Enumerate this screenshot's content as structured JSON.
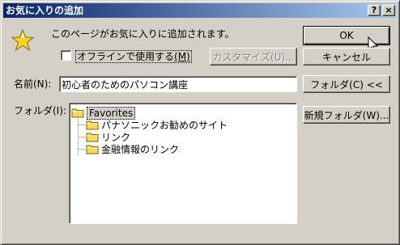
{
  "window": {
    "title": "お気に入りの追加",
    "help_btn": "?",
    "close_btn": "×"
  },
  "message": "このページがお気に入りに追加されます。",
  "offline": {
    "label_pre": "オフラインで使用する",
    "label_mnemonic": "(M)",
    "checked": false
  },
  "buttons": {
    "ok": "OK",
    "cancel": "キャンセル",
    "customize": "カスタマイズ(U)...",
    "folder_toggle": "フォルダ(C) <<",
    "new_folder": "新規フォルダ(W)..."
  },
  "name_field": {
    "label": "名前(N):",
    "value": "初心者のためのパソコン講座"
  },
  "folder_label": "フォルダ(I):",
  "tree": {
    "root": "Favorites",
    "children": [
      "パナソニックお勧めのサイト",
      "リンク",
      "金融情報のリンク"
    ]
  },
  "colors": {
    "title_start": "#0a246a",
    "title_end": "#a6caf0",
    "face": "#d4d0c8",
    "star": "#f7d02e",
    "folder": "#f5d865"
  }
}
